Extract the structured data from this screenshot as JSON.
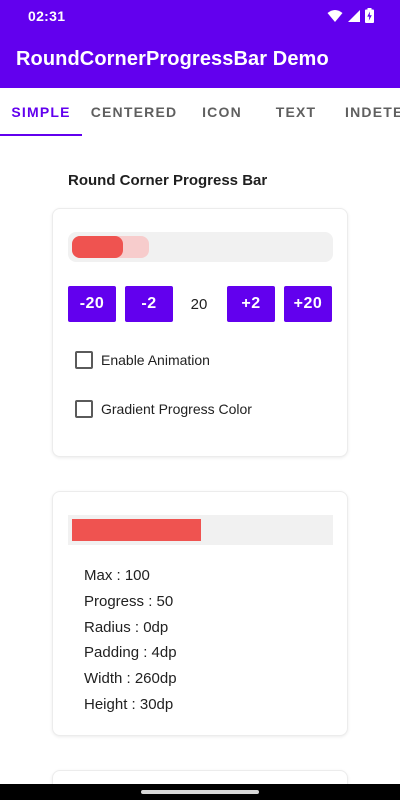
{
  "status_bar": {
    "time": "02:31",
    "icons": [
      "wifi-icon",
      "signal-icon",
      "battery-charging-icon"
    ]
  },
  "app_bar": {
    "title": "RoundCornerProgressBar Demo",
    "color": "#6200ee"
  },
  "tabs": [
    {
      "label": "SIMPLE",
      "active": true
    },
    {
      "label": "CENTERED",
      "active": false
    },
    {
      "label": "ICON",
      "active": false
    },
    {
      "label": "TEXT",
      "active": false
    },
    {
      "label": "INDETERMINATE",
      "active": false
    }
  ],
  "section": {
    "title": "Round Corner Progress Bar"
  },
  "demo_card": {
    "progress": {
      "max": 100,
      "progress": 20,
      "secondary_progress": 30,
      "progress_color": "#ef5350",
      "secondary_color": "#f7cccc",
      "track_color": "#f1f1f1"
    },
    "buttons": {
      "minus20": "-20",
      "minus2": "-2",
      "plus2": "+2",
      "plus20": "+20"
    },
    "value": "20",
    "checkboxes": {
      "animation": {
        "label": "Enable Animation",
        "checked": false
      },
      "gradient": {
        "label": "Gradient Progress Color",
        "checked": false
      }
    }
  },
  "info_card": {
    "progress": {
      "max": 100,
      "progress": 50,
      "progress_color": "#ef5350",
      "track_color": "#f1f1f1"
    },
    "lines": [
      "Max : 100",
      "Progress : 50",
      "Radius : 0dp",
      "Padding : 4dp",
      "Width : 260dp",
      "Height : 30dp"
    ]
  }
}
